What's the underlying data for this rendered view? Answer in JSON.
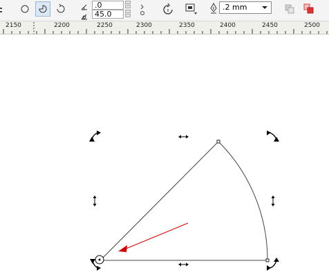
{
  "toolbar": {
    "shape_buttons": [
      {
        "name": "ellipse-mode-icon",
        "active": false
      },
      {
        "name": "pie-mode-icon",
        "active": true
      },
      {
        "name": "arc-mode-icon",
        "active": false
      }
    ],
    "start_angle_value": ".0",
    "end_angle_value": "45.0",
    "outline_width_value": ".2 mm"
  },
  "ruler": {
    "labels": [
      "2150",
      "2200",
      "2250",
      "2300",
      "2350",
      "2400",
      "2450",
      "2500"
    ]
  },
  "colors": {
    "toolbar_bg": "#f4f4f4",
    "ruler_bg": "#f0f0ea",
    "pie_outline": "#444444",
    "annotation_arrow": "#cc0000"
  }
}
